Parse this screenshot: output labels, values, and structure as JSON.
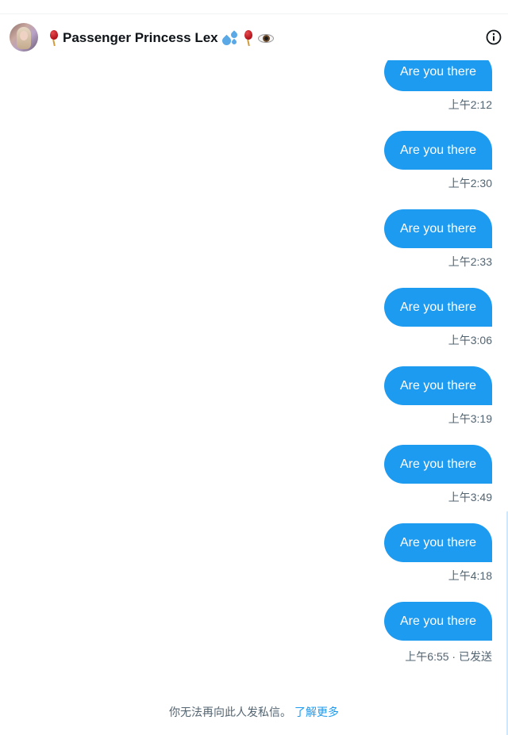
{
  "conversation": {
    "name": "Passenger Princess Lex",
    "emojis_after_name": [
      "water-drops",
      "balloon",
      "eye"
    ]
  },
  "header": {
    "info_icon": "info-icon",
    "avatar": "profile-avatar"
  },
  "messages": [
    {
      "text": "Are you there",
      "time": "上午2:12"
    },
    {
      "text": "Are you there",
      "time": "上午2:30"
    },
    {
      "text": "Are you there",
      "time": "上午2:33"
    },
    {
      "text": "Are you there",
      "time": "上午3:06"
    },
    {
      "text": "Are you there",
      "time": "上午3:19"
    },
    {
      "text": "Are you there",
      "time": "上午3:49"
    },
    {
      "text": "Are you there",
      "time": "上午4:18"
    },
    {
      "text": "Are you there",
      "time": "上午6:55 · 已发送"
    }
  ],
  "footer": {
    "notice": "你无法再向此人发私信。",
    "learn_more": "了解更多"
  },
  "colors": {
    "accent": "#1d9bf0",
    "secondary_text": "#536471",
    "primary_text": "#0f1419"
  }
}
